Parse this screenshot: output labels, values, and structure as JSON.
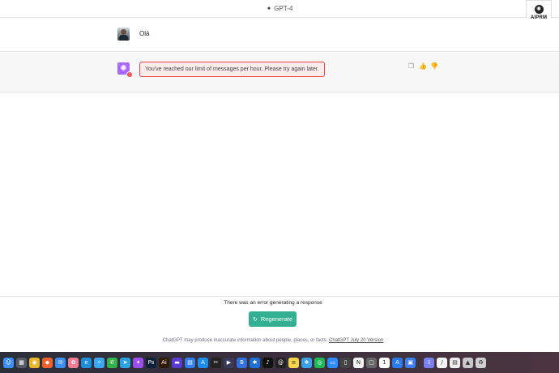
{
  "header": {
    "model_label": "GPT-4",
    "spark_icon": "sparkle-icon"
  },
  "aiprm": {
    "label": "AIPRM",
    "icon": "aiprm-logo-icon"
  },
  "conversation": {
    "user_message": "Olá",
    "assistant_error": "You've reached our limit of messages per hour. Please try again later.",
    "error_badge": "!",
    "actions": [
      "copy-icon",
      "thumbs-up-icon",
      "thumbs-down-icon"
    ]
  },
  "footer": {
    "error_text": "There was an error generating a response",
    "regenerate_label": "Regenerate",
    "disclaimer_text": "ChatGPT may produce inaccurate information about people, places, or facts.",
    "version_link": "ChatGPT July 20 Version"
  },
  "colors": {
    "accent": "#10a37f",
    "error": "#ef4146",
    "gpt4_avatar": "#ab68ff"
  },
  "dock": [
    {
      "name": "finder-icon",
      "color": "#3a8ef6",
      "glyph": "☺"
    },
    {
      "name": "launchpad-icon",
      "color": "#555a66",
      "glyph": "▦"
    },
    {
      "name": "chrome-icon",
      "color": "#e8b52c",
      "glyph": "◉"
    },
    {
      "name": "brave-icon",
      "color": "#f0612c",
      "glyph": "◆"
    },
    {
      "name": "mail-icon",
      "color": "#3b8ff3",
      "glyph": "✉"
    },
    {
      "name": "photos-icon",
      "color": "#f27c92",
      "glyph": "✿"
    },
    {
      "name": "edge-icon",
      "color": "#1d8fd8",
      "glyph": "e"
    },
    {
      "name": "safari-icon",
      "color": "#3ba7f0",
      "glyph": "✧"
    },
    {
      "name": "whatsapp-icon",
      "color": "#2fb34a",
      "glyph": "✆"
    },
    {
      "name": "telegram-icon",
      "color": "#2aa4e0",
      "glyph": "➤"
    },
    {
      "name": "messenger-icon",
      "color": "#9b4ff0",
      "glyph": "✦"
    },
    {
      "name": "photoshop-icon",
      "color": "#0d2238",
      "glyph": "Ps"
    },
    {
      "name": "illustrator-icon",
      "color": "#2e1a05",
      "glyph": "Ai"
    },
    {
      "name": "app-icon",
      "color": "#5a3bd0",
      "glyph": "▬"
    },
    {
      "name": "keynote-icon",
      "color": "#2f7ef0",
      "glyph": "▤"
    },
    {
      "name": "app-store-icon",
      "color": "#1c8ef2",
      "glyph": "A"
    },
    {
      "name": "capcut-icon",
      "color": "#222222",
      "glyph": "✂"
    },
    {
      "name": "play-icon",
      "color": "#3a3a5a",
      "glyph": "▶"
    },
    {
      "name": "docs-icon",
      "color": "#2f6fe0",
      "glyph": "B"
    },
    {
      "name": "bluetooth-icon",
      "color": "#1e6fd9",
      "glyph": "✱"
    },
    {
      "name": "tiktok-icon",
      "color": "#111111",
      "glyph": "♪"
    },
    {
      "name": "threads-icon",
      "color": "#222222",
      "glyph": "@"
    },
    {
      "name": "notes-icon",
      "color": "#f5d44a",
      "glyph": "≡"
    },
    {
      "name": "telegram-alt-icon",
      "color": "#3aa0e8",
      "glyph": "❖"
    },
    {
      "name": "spotify-icon",
      "color": "#1db954",
      "glyph": "◎"
    },
    {
      "name": "zoom-icon",
      "color": "#2d8cff",
      "glyph": "▭"
    },
    {
      "name": "screen-icon",
      "color": "#444444",
      "glyph": "▯"
    },
    {
      "name": "notion-icon",
      "color": "#f2f2f2",
      "glyph": "N"
    },
    {
      "name": "frame-icon",
      "color": "#666666",
      "glyph": "▢"
    },
    {
      "name": "calendar-icon",
      "color": "#ffffff",
      "glyph": "1"
    },
    {
      "name": "xcode-icon",
      "color": "#2a7bf0",
      "glyph": "A"
    },
    {
      "name": "files-icon",
      "color": "#3c7ff2",
      "glyph": "▣"
    },
    {
      "name": "downloads-icon",
      "color": "#7b7ff5",
      "glyph": "⇩"
    },
    {
      "name": "pages-icon",
      "color": "#f5f5f5",
      "glyph": "/"
    },
    {
      "name": "document-icon",
      "color": "#eeeeee",
      "glyph": "▤"
    },
    {
      "name": "drive-icon",
      "color": "#c9c9c9",
      "glyph": "▲"
    },
    {
      "name": "trash-icon",
      "color": "#cfcfcf",
      "glyph": "♻"
    }
  ]
}
